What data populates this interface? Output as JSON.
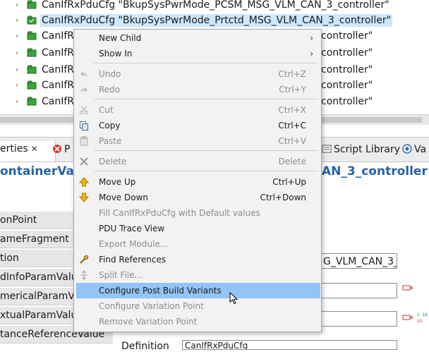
{
  "tree": {
    "rows": [
      {
        "label": "CanIfRxPduCfg \"BkupSysPwrMode_PCSM_MSG_VLM_CAN_3_controller\"",
        "selected": false
      },
      {
        "label": "CanIfRxPduCfg \"BkupSysPwrMode_Prtctd_MSG_VLM_CAN_3_controller\"",
        "selected": true
      },
      {
        "label": "CanIfRx",
        "tail": "controller\""
      },
      {
        "label": "CanIfRx",
        "tail": "controller\""
      },
      {
        "label": "CanIfRx",
        "tail": "controller\""
      },
      {
        "label": "CanIfRx",
        "tail": "controller\""
      },
      {
        "label": "CanIfRx",
        "tail": "controller\""
      }
    ]
  },
  "panel": {
    "tabs": {
      "properties": "erties",
      "problems": "P",
      "script_library": "Script Library",
      "variants": "Va"
    },
    "title_left": "ontainerValu",
    "title_right": "AN_3_controller",
    "side_items": [
      "onPoint",
      "ameFragment",
      "tion",
      "dInfoParamValu",
      "mericalParamVa",
      "xtualParamValue",
      "tanceReferenceValue"
    ],
    "field_value": "G_VLM_CAN_3_c",
    "definition_label": "Definition",
    "definition_value": "CanIfRxPduCfg"
  },
  "menu": {
    "items": [
      {
        "label": "New Child",
        "shortcut": "",
        "submenu": true,
        "enabled": true,
        "icon": ""
      },
      {
        "label": "Show In",
        "shortcut": "",
        "submenu": true,
        "enabled": true,
        "icon": ""
      },
      {
        "label": "Undo",
        "shortcut": "Ctrl+Z",
        "enabled": false,
        "icon": "undo-icon"
      },
      {
        "label": "Redo",
        "shortcut": "Ctrl+Y",
        "enabled": false,
        "icon": "redo-icon"
      },
      {
        "label": "Cut",
        "shortcut": "Ctrl+X",
        "enabled": false,
        "icon": "cut-icon"
      },
      {
        "label": "Copy",
        "shortcut": "Ctrl+C",
        "enabled": true,
        "icon": "copy-icon"
      },
      {
        "label": "Paste",
        "shortcut": "Ctrl+V",
        "enabled": false,
        "icon": "paste-icon"
      },
      {
        "label": "Delete",
        "shortcut": "Delete",
        "enabled": false,
        "icon": "delete-icon"
      },
      {
        "label": "Move Up",
        "shortcut": "Ctrl+Up",
        "enabled": true,
        "icon": "arrow-up-icon"
      },
      {
        "label": "Move Down",
        "shortcut": "Ctrl+Down",
        "enabled": true,
        "icon": "arrow-down-icon"
      },
      {
        "label": "Fill CanIfRxPduCfg with Default values",
        "shortcut": "",
        "enabled": false,
        "icon": ""
      },
      {
        "label": "PDU Trace View",
        "shortcut": "",
        "enabled": true,
        "icon": ""
      },
      {
        "label": "Export Module...",
        "shortcut": "",
        "enabled": false,
        "icon": ""
      },
      {
        "label": "Find References",
        "shortcut": "",
        "enabled": true,
        "icon": "find-references-icon"
      },
      {
        "label": "Split File...",
        "shortcut": "",
        "enabled": false,
        "icon": "split-file-icon"
      },
      {
        "label": "Configure Post Build Variants",
        "shortcut": "",
        "enabled": true,
        "highlight": true,
        "icon": ""
      },
      {
        "label": "Configure Variation Point",
        "shortcut": "",
        "enabled": false,
        "icon": ""
      },
      {
        "label": "Remove Variation Point",
        "shortcut": "",
        "enabled": false,
        "icon": ""
      }
    ]
  },
  "colors": {
    "selection": "#cde8ff",
    "menu_highlight": "#92c4f5",
    "title_blue": "#2563a8",
    "icon_green": "#3ea33e"
  }
}
